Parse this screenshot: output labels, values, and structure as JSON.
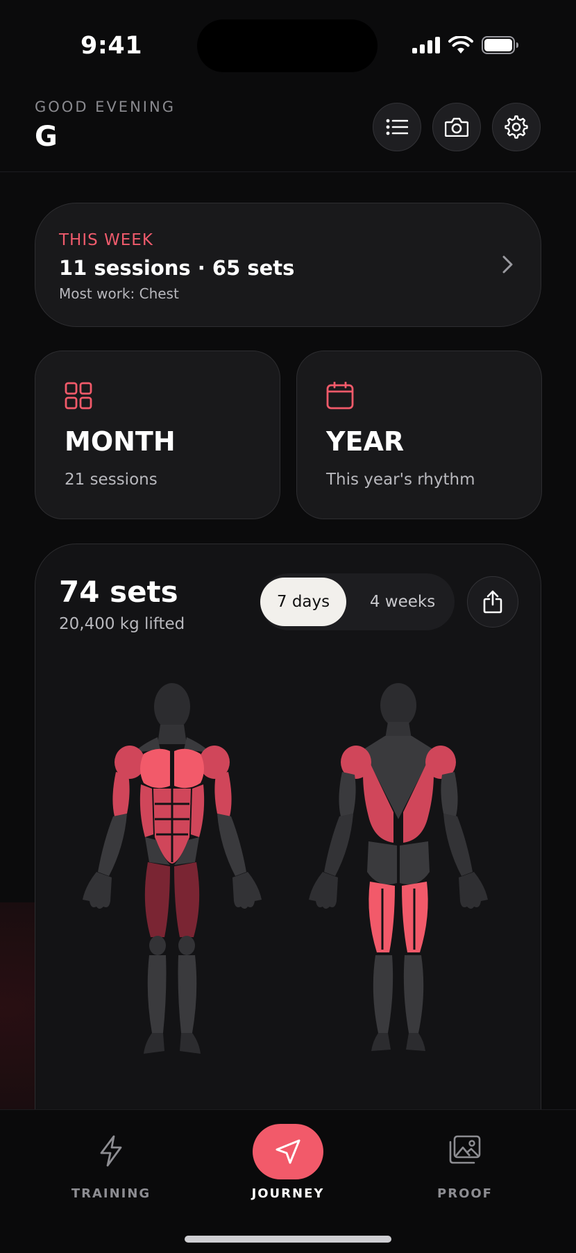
{
  "status_bar": {
    "time": "9:41"
  },
  "header": {
    "greeting": "GOOD EVENING",
    "user_initial": "G"
  },
  "week_card": {
    "label": "THIS WEEK",
    "summary": "11 sessions · 65 sets",
    "subtitle": "Most work: Chest"
  },
  "month_card": {
    "title": "MONTH",
    "subtitle": "21 sessions"
  },
  "year_card": {
    "title": "YEAR",
    "subtitle": "This year's rhythm"
  },
  "muscle_card": {
    "title": "74 sets",
    "subtitle": "20,400 kg lifted",
    "range_options": [
      "7 days",
      "4 weeks"
    ],
    "selected_range": "7 days"
  },
  "tab_bar": {
    "tabs": [
      {
        "label": "TRAINING",
        "icon": "lightning-icon"
      },
      {
        "label": "JOURNEY",
        "icon": "navigation-arrow-icon",
        "active": true
      },
      {
        "label": "PROOF",
        "icon": "photo-gallery-icon"
      }
    ]
  },
  "colors": {
    "accent": "#f25a6a",
    "background": "#0b0b0c",
    "card": "#19191b",
    "muscle_high": "#f25a6a",
    "muscle_mid": "#d0465a",
    "muscle_low": "#7a2533",
    "muscle_idle": "#3a3a3d"
  }
}
